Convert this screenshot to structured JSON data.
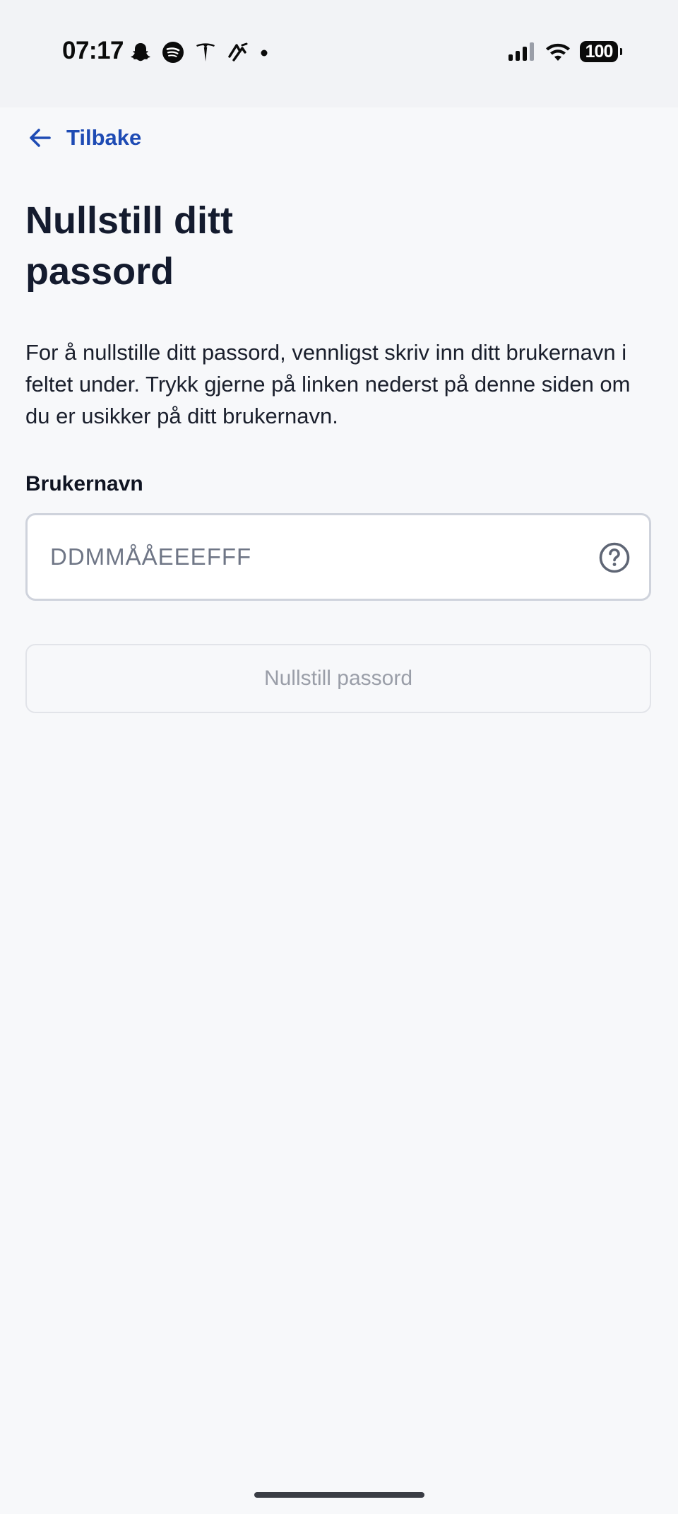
{
  "status_bar": {
    "time": "07:17",
    "notification_icons": [
      "snapchat-icon",
      "spotify-icon",
      "tesla-icon",
      "strava-icon",
      "dot-icon"
    ],
    "battery_level": "100"
  },
  "nav": {
    "back_label": "Tilbake"
  },
  "page": {
    "title": "Nullstill ditt passord",
    "description": "For å nullstille ditt passord, vennligst skriv inn ditt brukernavn i feltet under. Trykk gjerne på linken nederst på denne siden om du er usikker på ditt brukernavn."
  },
  "form": {
    "username_label": "Brukernavn",
    "username_placeholder": "DDMMÅÅEEEFFF",
    "username_value": "",
    "submit_label": "Nullstill passord",
    "submit_disabled": true
  },
  "colors": {
    "accent": "#1e4bb4",
    "title": "#141b2e",
    "background": "#f7f8fa",
    "disabled_text": "#9a9ea8"
  }
}
